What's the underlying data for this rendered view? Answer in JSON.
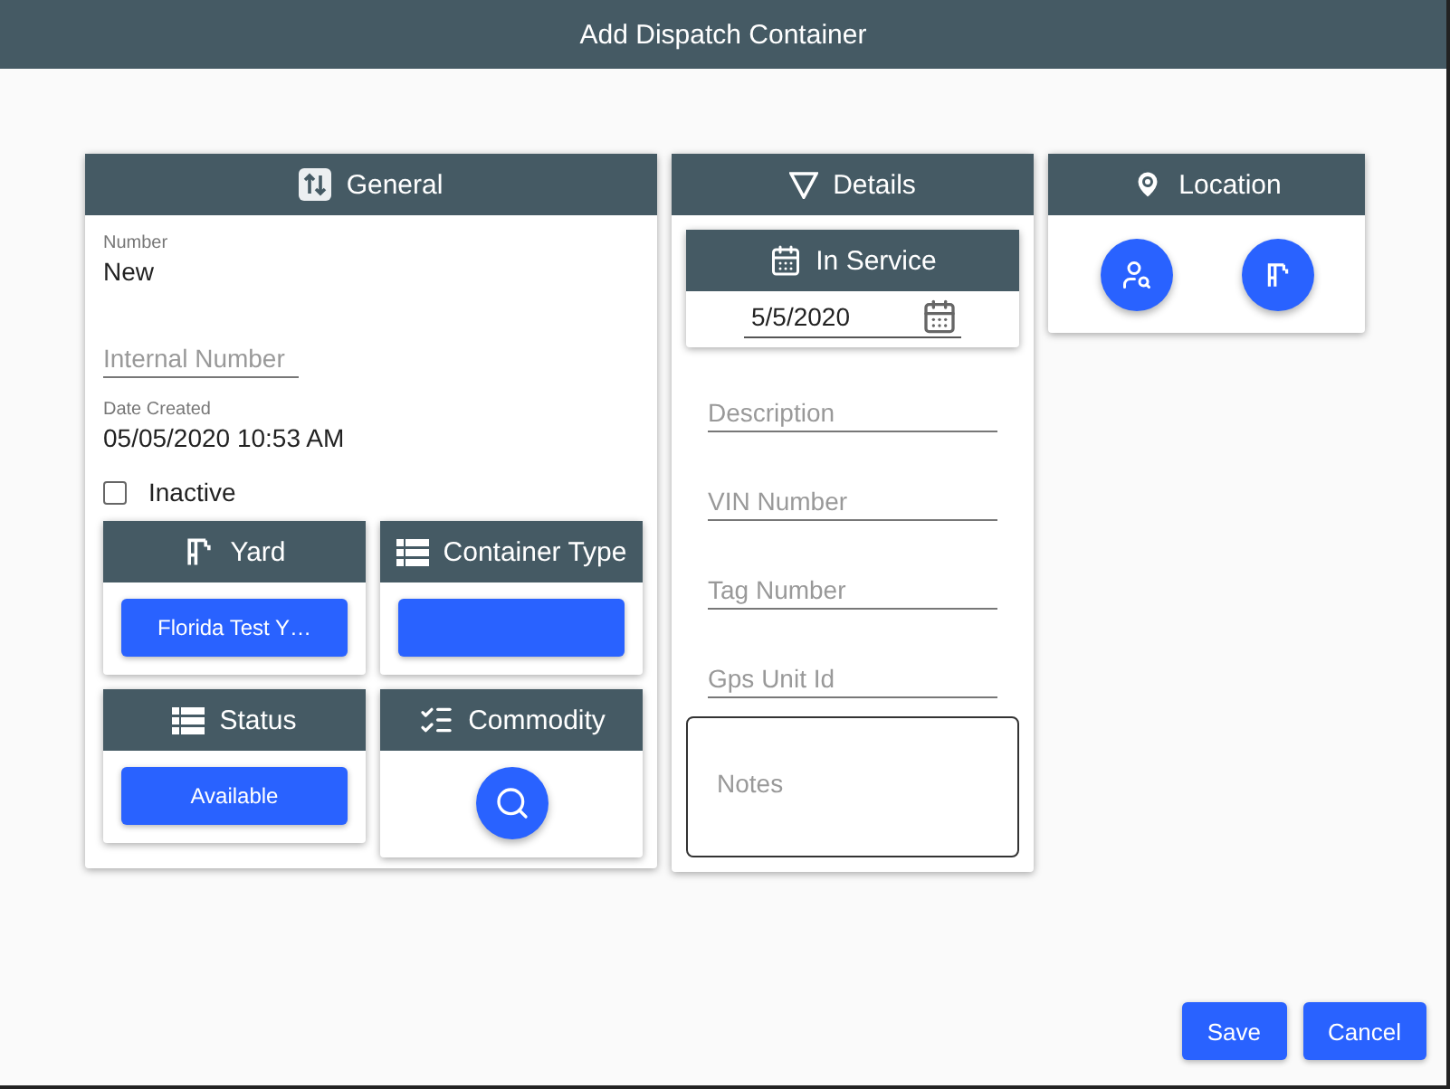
{
  "window": {
    "title": "Add Dispatch Container"
  },
  "general": {
    "title": "General",
    "number": {
      "label": "Number",
      "value": "New"
    },
    "internal_number": {
      "placeholder": "Internal Number"
    },
    "date_created": {
      "label": "Date Created",
      "value": "05/05/2020 10:53 AM"
    },
    "inactive": {
      "label": "Inactive",
      "checked": false
    },
    "subcards": [
      {
        "title": "Yard",
        "kind": "button",
        "value": "Florida Test Y…"
      },
      {
        "title": "Container Type",
        "kind": "button"
      },
      {
        "title": "Status",
        "kind": "button",
        "value": "Available"
      },
      {
        "title": "Commodity",
        "kind": "search"
      }
    ]
  },
  "details": {
    "title": "Details",
    "in_service": {
      "title": "In Service",
      "value": "5/5/2020"
    },
    "fields": [
      {
        "placeholder": "Description"
      },
      {
        "placeholder": "VIN Number"
      },
      {
        "placeholder": "Tag Number"
      },
      {
        "placeholder": "Gps Unit Id"
      }
    ],
    "notes": {
      "placeholder": "Notes"
    }
  },
  "location": {
    "title": "Location"
  },
  "buttons": [
    "Save",
    "Cancel"
  ]
}
